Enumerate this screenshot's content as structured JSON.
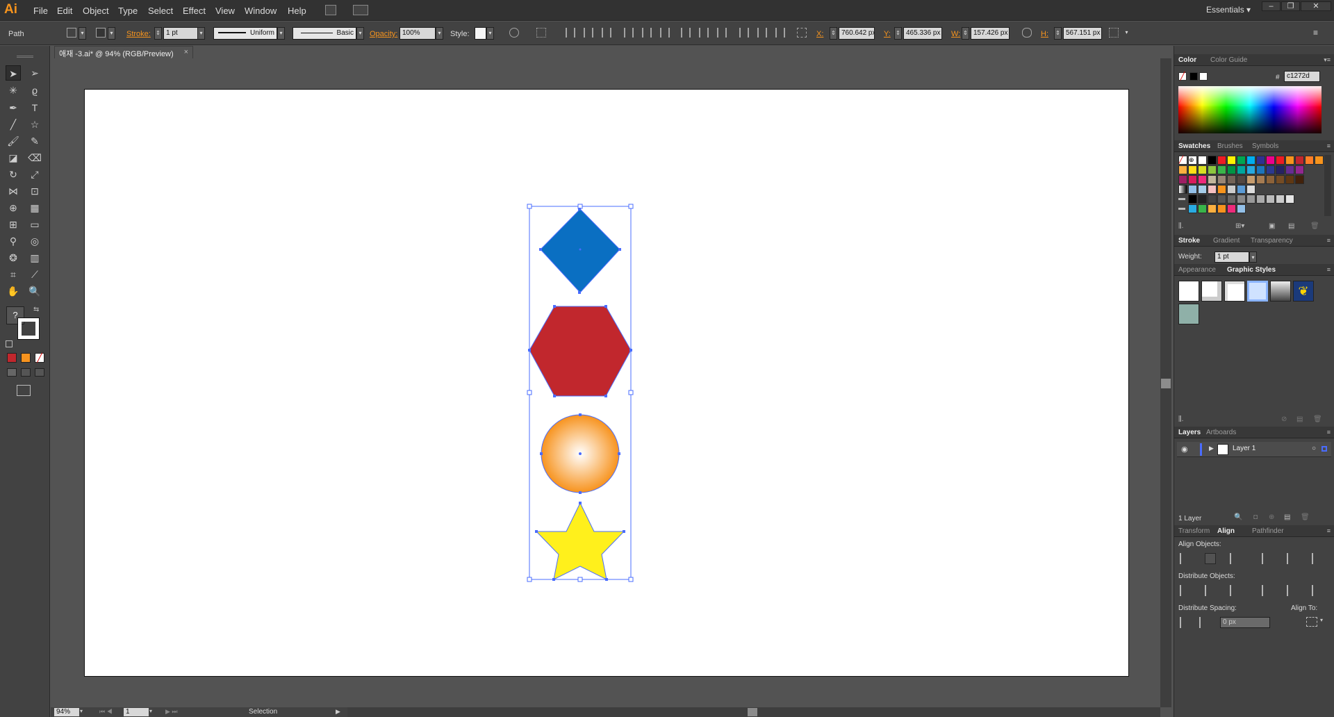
{
  "app": {
    "logo": "Ai",
    "workspace": "Essentials"
  },
  "menu": [
    "File",
    "Edit",
    "Object",
    "Type",
    "Select",
    "Effect",
    "View",
    "Window",
    "Help"
  ],
  "control": {
    "object_type": "Path",
    "stroke_label": "Stroke:",
    "stroke_weight": "1 pt",
    "profile": "Uniform",
    "brush": "Basic",
    "opacity_label": "Opacity:",
    "opacity": "100%",
    "style_label": "Style:",
    "x_label": "X:",
    "x": "760.642 px",
    "y_label": "Y:",
    "y": "465.336 px",
    "w_label": "W:",
    "w": "157.426 px",
    "h_label": "H:",
    "h": "567.151 px"
  },
  "document": {
    "tab_title": "애재 -3.ai* @ 94% (RGB/Preview)",
    "close": "×"
  },
  "canvas": {
    "shapes": [
      {
        "name": "diamond",
        "fill": "#0a6fc2"
      },
      {
        "name": "hexagon",
        "fill": "#c1272d"
      },
      {
        "name": "circle",
        "fill": "#f7931e"
      },
      {
        "name": "star",
        "fill": "#fff01c"
      }
    ]
  },
  "status": {
    "zoom": "94%",
    "artboard": "1",
    "tool": "Selection"
  },
  "panels": {
    "color": {
      "tabs": [
        "Color",
        "Color Guide"
      ],
      "hex_label": "#",
      "hex": "c1272d"
    },
    "swatches": {
      "tabs": [
        "Swatches",
        "Brushes",
        "Symbols"
      ]
    },
    "stroke": {
      "tabs": [
        "Stroke",
        "Gradient",
        "Transparency"
      ],
      "weight_label": "Weight:",
      "weight": "1 pt"
    },
    "graphic_styles": {
      "tabs": [
        "Appearance",
        "Graphic Styles"
      ]
    },
    "layers": {
      "tabs": [
        "Layers",
        "Artboards"
      ],
      "layer_name": "Layer 1",
      "count": "1 Layer"
    },
    "align": {
      "tabs": [
        "Transform",
        "Align",
        "Pathfinder"
      ],
      "align_objects": "Align Objects:",
      "distribute_objects": "Distribute Objects:",
      "distribute_spacing": "Distribute Spacing:",
      "align_to": "Align To:",
      "spacing_value": "0 px"
    }
  },
  "colors": {
    "accent": "#f7941d",
    "selection": "#4a6cff"
  }
}
